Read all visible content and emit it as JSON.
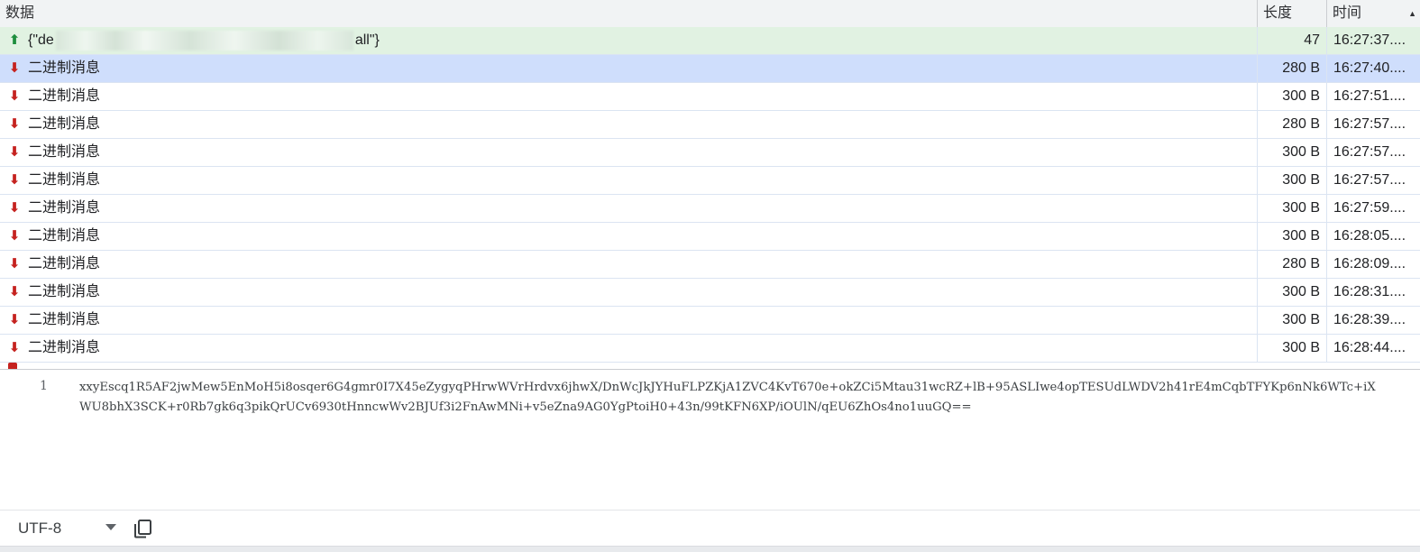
{
  "columns": {
    "data": "数据",
    "length": "长度",
    "time": "时间",
    "sort_indicator": "▲"
  },
  "icons": {
    "sent": "arrow-up-icon",
    "received": "arrow-down-icon",
    "sent_color": "#1e8e3e",
    "received_color": "#c5221f"
  },
  "messages": [
    {
      "direction": "sent",
      "data_start": "{\"de",
      "data_end": "all\"}",
      "length": "47",
      "time": "16:27:37...."
    },
    {
      "direction": "received",
      "data": "二进制消息",
      "length": "280 B",
      "time": "16:27:40...."
    },
    {
      "direction": "received",
      "data": "二进制消息",
      "length": "300 B",
      "time": "16:27:51...."
    },
    {
      "direction": "received",
      "data": "二进制消息",
      "length": "280 B",
      "time": "16:27:57...."
    },
    {
      "direction": "received",
      "data": "二进制消息",
      "length": "300 B",
      "time": "16:27:57...."
    },
    {
      "direction": "received",
      "data": "二进制消息",
      "length": "300 B",
      "time": "16:27:57...."
    },
    {
      "direction": "received",
      "data": "二进制消息",
      "length": "300 B",
      "time": "16:27:59...."
    },
    {
      "direction": "received",
      "data": "二进制消息",
      "length": "300 B",
      "time": "16:28:05...."
    },
    {
      "direction": "received",
      "data": "二进制消息",
      "length": "280 B",
      "time": "16:28:09...."
    },
    {
      "direction": "received",
      "data": "二进制消息",
      "length": "300 B",
      "time": "16:28:31...."
    },
    {
      "direction": "received",
      "data": "二进制消息",
      "length": "300 B",
      "time": "16:28:39...."
    },
    {
      "direction": "received",
      "data": "二进制消息",
      "length": "300 B",
      "time": "16:28:44...."
    }
  ],
  "selected_index": 1,
  "detail": {
    "line_number": "1",
    "lines": [
      "xxyEscq1R5AF2jwMew5EnMoH5i8osqer6G4gmr0I7X45eZygyqPHrwWVrHrdvx6jhwX/DnWcJkJYHuFLPZKjA1ZVC4KvT670e+okZCi5Mtau31wcRZ+lB+95ASLIwe4opTESUdLWDV2h41rE4mCqbTFYKp6nNk6WTc+iX",
      "WU8bhX3SCK+r0Rb7gk6q3pikQrUCv6930tHnncwWv2BJUf3i2FnAwMNi+v5eZna9AG0YgPtoiH0+43n/99tKFN6XP/iOUlN/qEU6ZhOs4no1uuGQ=="
    ]
  },
  "toolbar": {
    "encoding": "UTF-8",
    "dropdown_icon": "chevron-down-icon",
    "copy_icon": "copy-icon"
  }
}
